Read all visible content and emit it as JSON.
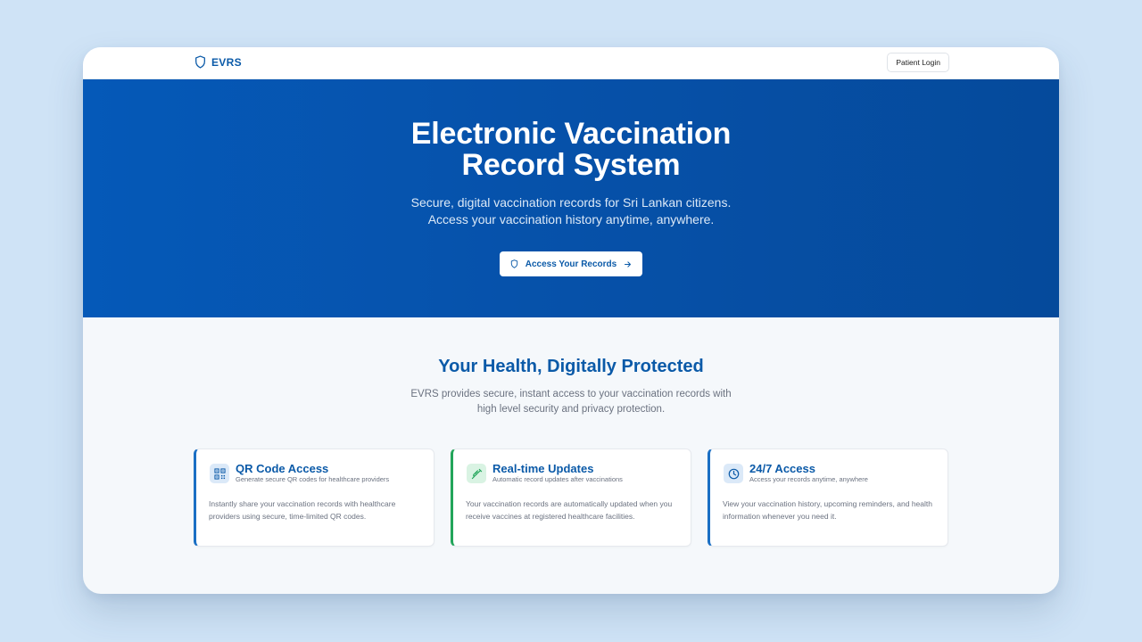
{
  "nav": {
    "brand": "EVRS",
    "login_label": "Patient Login"
  },
  "hero": {
    "title_line1": "Electronic Vaccination",
    "title_line2": "Record System",
    "subtitle_line1": "Secure, digital vaccination records for Sri Lankan citizens.",
    "subtitle_line2": "Access your vaccination history anytime, anywhere.",
    "cta_label": "Access Your Records"
  },
  "features": {
    "title": "Your Health, Digitally Protected",
    "desc_line1": "EVRS provides secure, instant access to your vaccination records with",
    "desc_line2": "high level security and privacy protection.",
    "cards": [
      {
        "icon": "qr-code-icon",
        "title": "QR Code Access",
        "subtitle": "Generate secure QR codes for healthcare providers",
        "body": "Instantly share your vaccination records with healthcare providers using secure, time-limited QR codes."
      },
      {
        "icon": "syringe-icon",
        "title": "Real-time Updates",
        "subtitle": "Automatic record updates after vaccinations",
        "body": "Your vaccination records are automatically updated when you receive vaccines at registered healthcare facilities."
      },
      {
        "icon": "clock-icon",
        "title": "24/7 Access",
        "subtitle": "Access your records anytime, anywhere",
        "body": "View your vaccination history, upcoming reminders, and health information whenever you need it."
      }
    ]
  },
  "colors": {
    "brand_blue": "#0b5aa8",
    "hero_blue": "#0559b8",
    "accent_green": "#22a55a",
    "page_bg": "#cfe3f6"
  }
}
